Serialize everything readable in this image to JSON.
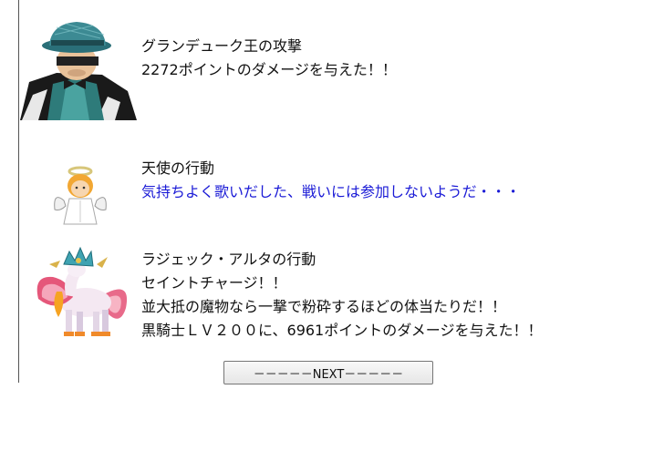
{
  "battle_log": {
    "entries": [
      {
        "sprite": "king-in-fedora-sprite",
        "lines": [
          "グランデューク王の攻撃",
          "2272ポイントのダメージを与えた！！"
        ]
      },
      {
        "sprite": "angel-sprite",
        "title": "天使の行動",
        "message": "気持ちよく歌いだした、戦いには参加しないようだ・・・",
        "message_color": "#1a1ad6"
      },
      {
        "sprite": "winged-pegasus-sprite",
        "lines": [
          "ラジェック・アルタの行動",
          "セイントチャージ！！",
          "並大抵の魔物なら一撃で粉砕するほどの体当たりだ！！",
          "黒騎士ＬＶ２００に、6961ポイントのダメージを与えた！！"
        ]
      }
    ]
  },
  "controls": {
    "next_label": "－－－－－NEXT－－－－－"
  }
}
